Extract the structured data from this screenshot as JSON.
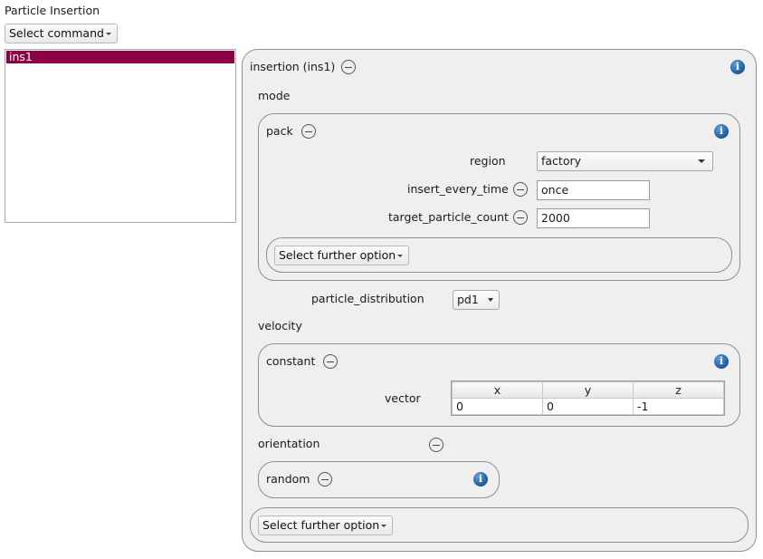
{
  "window": {
    "title": "Particle Insertion"
  },
  "toolbar": {
    "select_command": "Select command"
  },
  "command_list": {
    "items": [
      "ins1"
    ]
  },
  "insertion": {
    "title": "insertion (ins1)",
    "mode_label": "mode",
    "pack": {
      "title": "pack",
      "region_label": "region",
      "region_value": "factory",
      "insert_every_time_label": "insert_every_time",
      "insert_every_time_value": "once",
      "target_particle_count_label": "target_particle_count",
      "target_particle_count_value": "2000",
      "select_further_option": "Select further option"
    },
    "particle_distribution_label": "particle_distribution",
    "particle_distribution_value": "pd1",
    "velocity_label": "velocity",
    "constant": {
      "title": "constant",
      "vector_label": "vector",
      "columns": [
        "x",
        "y",
        "z"
      ],
      "values": [
        "0",
        "0",
        "-1"
      ]
    },
    "orientation_label": "orientation",
    "random": {
      "title": "random"
    },
    "select_further_option": "Select further option"
  },
  "icons": {
    "info": "info-icon",
    "remove": "minus-circle-icon",
    "dropdown": "chevron-down-icon"
  },
  "colors": {
    "selection": "#8c0046",
    "info_blue": "#1b5a9c",
    "group_bg": "#efefef"
  }
}
